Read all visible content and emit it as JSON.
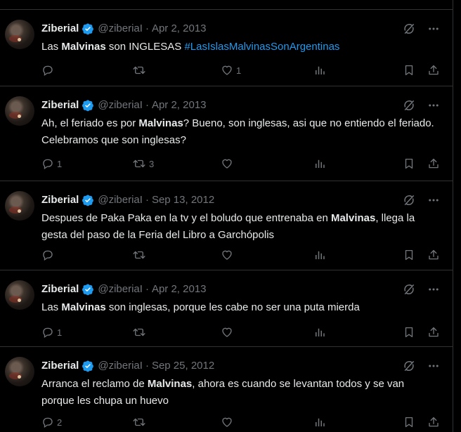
{
  "colors": {
    "background": "#000000",
    "text": "#e7e9ea",
    "muted": "#71767b",
    "accent": "#1d9bf0",
    "divider": "#2f3336"
  },
  "tweets": [
    {
      "name": "Ziberial",
      "handle": "@ziberiaI",
      "date": "Apr 2, 2013",
      "segments": [
        {
          "t": "Las ",
          "s": "plain"
        },
        {
          "t": "Malvinas",
          "s": "bold"
        },
        {
          "t": " son INGLESAS ",
          "s": "plain"
        },
        {
          "t": "#LasIslasMalvinasSonArgentinas",
          "s": "hashtag"
        }
      ],
      "replies": "",
      "retweets": "",
      "likes": "1"
    },
    {
      "name": "Ziberial",
      "handle": "@ziberiaI",
      "date": "Apr 2, 2013",
      "segments": [
        {
          "t": "Ah, el feriado es por ",
          "s": "plain"
        },
        {
          "t": "Malvinas",
          "s": "bold"
        },
        {
          "t": "? Bueno, son inglesas, asi que no entiendo el feriado. Celebramos que son inglesas?",
          "s": "plain"
        }
      ],
      "replies": "1",
      "retweets": "3",
      "likes": ""
    },
    {
      "name": "Ziberial",
      "handle": "@ziberiaI",
      "date": "Sep 13, 2012",
      "segments": [
        {
          "t": "Despues de Paka Paka en la tv y el boludo que entrenaba en ",
          "s": "plain"
        },
        {
          "t": "Malvinas",
          "s": "bold"
        },
        {
          "t": ", llega la gesta del paso de la Feria del Libro a Garchópolis",
          "s": "plain"
        }
      ],
      "replies": "",
      "retweets": "",
      "likes": ""
    },
    {
      "name": "Ziberial",
      "handle": "@ziberiaI",
      "date": "Apr 2, 2013",
      "segments": [
        {
          "t": "Las ",
          "s": "plain"
        },
        {
          "t": "Malvinas",
          "s": "bold"
        },
        {
          "t": " son inglesas, porque les cabe no ser una puta mierda",
          "s": "plain"
        }
      ],
      "replies": "1",
      "retweets": "",
      "likes": ""
    },
    {
      "name": "Ziberial",
      "handle": "@ziberiaI",
      "date": "Sep 25, 2012",
      "segments": [
        {
          "t": "Arranca el reclamo de ",
          "s": "plain"
        },
        {
          "t": "Malvinas",
          "s": "bold"
        },
        {
          "t": ", ahora es cuando se levantan todos y se van porque les chupa un huevo",
          "s": "plain"
        }
      ],
      "replies": "2",
      "retweets": "",
      "likes": ""
    }
  ],
  "icons": {
    "header": [
      "grok-icon",
      "more-icon"
    ],
    "actions": [
      "reply-icon",
      "retweet-icon",
      "like-icon",
      "views-icon",
      "bookmark-icon",
      "share-icon"
    ]
  }
}
